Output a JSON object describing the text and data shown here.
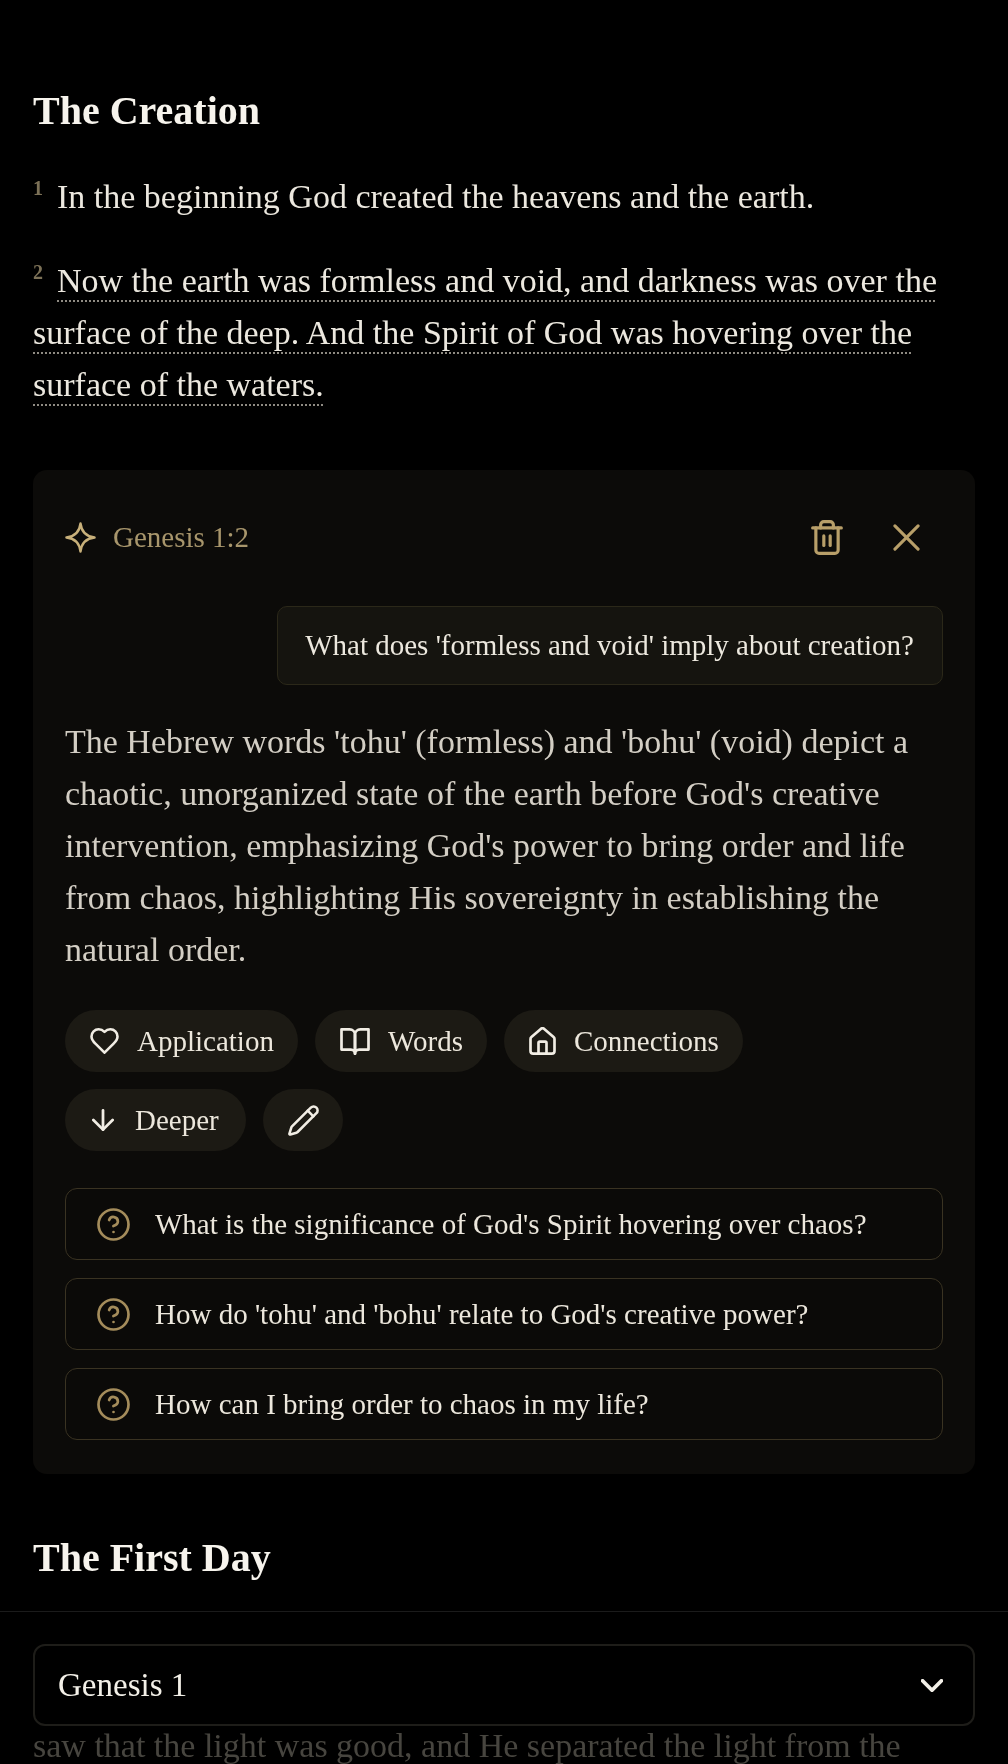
{
  "section": {
    "heading": "The Creation",
    "verses": [
      {
        "number": "1",
        "text": "In the beginning God created the heavens and the earth.",
        "selected": false
      },
      {
        "number": "2",
        "text": "Now the earth was formless and void, and darkness was over the surface of the deep. And the Spirit of God was hovering over the surface of the waters.",
        "selected": true
      }
    ]
  },
  "study_panel": {
    "reference": "Genesis 1:2",
    "question": "What does 'formless and void' imply about creation?",
    "answer": "The Hebrew words 'tohu' (formless) and 'bohu' (void) depict a chaotic, unorganized state of the earth before God's creative intervention, emphasizing God's power to bring order and life from chaos, highlighting His sovereignty in establishing the natural order.",
    "actions": [
      {
        "kind": "application",
        "label": "Application"
      },
      {
        "kind": "words",
        "label": "Words"
      },
      {
        "kind": "connections",
        "label": "Connections"
      },
      {
        "kind": "deeper",
        "label": "Deeper"
      },
      {
        "kind": "edit"
      }
    ],
    "suggestions": [
      "What is the significance of God's Spirit hovering over chaos?",
      "How do 'tohu' and 'bohu' relate to God's creative power?",
      "How can I bring order to chaos in my life?"
    ]
  },
  "next_section": {
    "heading": "The First Day",
    "text": "saw that the light was good, and He separated the light from the"
  },
  "chapter_picker": {
    "value": "Genesis 1"
  }
}
